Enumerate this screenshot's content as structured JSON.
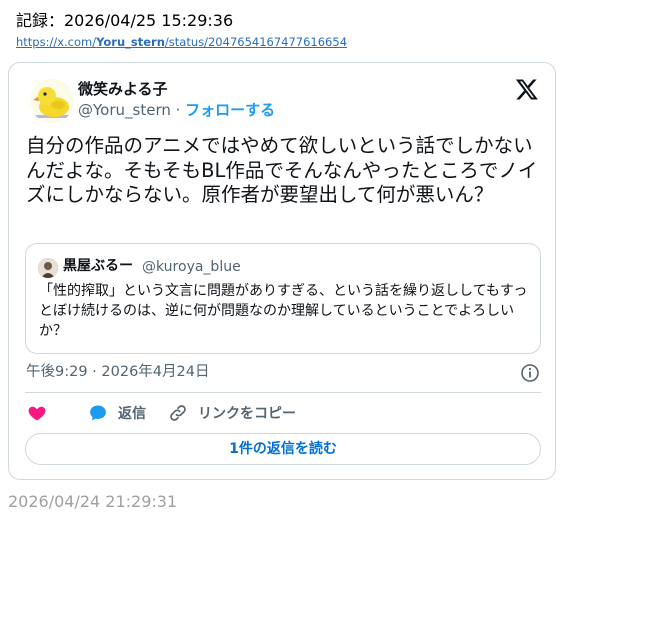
{
  "record": {
    "label": "記録：2026/04/25 15:29:36"
  },
  "link": {
    "prefix": "https://x.com/",
    "user": "Yoru_stern",
    "suffix": "/status/2047654167477616654"
  },
  "tweet": {
    "display_name": "微笑みよる子",
    "handle": "@Yoru_stern",
    "separator": " · ",
    "follow_label": "フォローする",
    "text": "自分の作品のアニメではやめて欲しいという話でしかないんだよな。そもそもBL作品でそんなんやったところでノイズにしかならない。原作者が要望出して何が悪いん？",
    "timestamp": "午後9:29 · 2026年4月24日",
    "reply_label": "返信",
    "copy_link_label": "リンクをコピー",
    "read_replies_label": "1件の返信を読む"
  },
  "quote": {
    "display_name": "黒屋ぶるー",
    "handle": "@kuroya_blue",
    "text": "「性的搾取」という文言に問題がありすぎる、という話を繰り返ししてもすっとぼけ続けるのは、逆に何が問題なのか理解しているということでよろしいか？"
  },
  "footer": {
    "date": "2026/04/24 21:29:31"
  },
  "icons": {
    "logo": "x-logo-icon",
    "info": "info-icon",
    "like": "heart-icon",
    "reply": "reply-bubble-icon",
    "copy": "link-icon",
    "avatar": "duck-avatar",
    "quote_avatar": "quote-avatar"
  },
  "colors": {
    "accent": "#1d9bf0",
    "heart": "#f91880",
    "link": "#2a6ebb",
    "border": "#cfd9de",
    "muted": "#536471"
  }
}
